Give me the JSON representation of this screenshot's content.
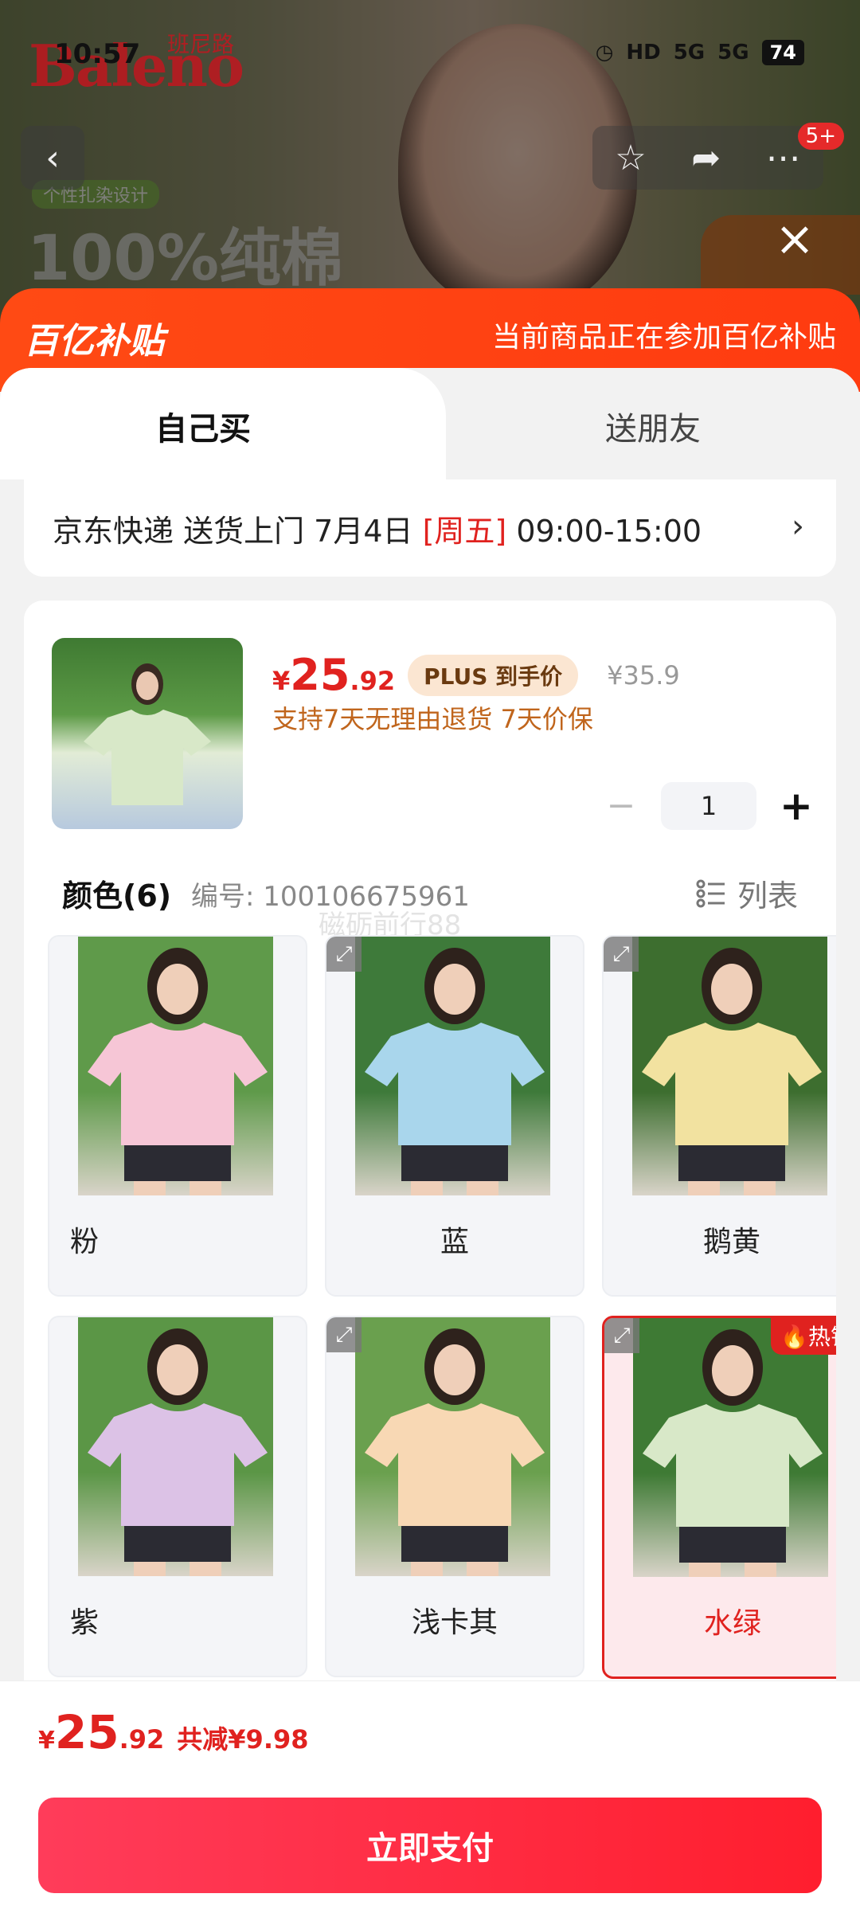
{
  "status_bar": {
    "time": "10:57",
    "icons": [
      "HD",
      "5G",
      "5G"
    ],
    "battery": "74"
  },
  "background": {
    "brand": "Baleno",
    "brand_cn": "班尼路",
    "tag": "个性扎染设计",
    "headline": "100%纯棉",
    "badge_count": "5+"
  },
  "subsidy": {
    "logo": "百亿补贴",
    "text": "当前商品正在参加百亿补贴"
  },
  "tabs": [
    {
      "label": "自己买"
    },
    {
      "label": "送朋友"
    }
  ],
  "delivery": {
    "prefix": "京东快递 送货上门 7月4日 ",
    "weekday": "[周五]",
    "time": " 09:00-15:00",
    "arrow": "›"
  },
  "product": {
    "price_symbol": "¥",
    "price_int": "25",
    "price_dec": ".92",
    "plus_badge": "PLUS 到手价",
    "original_price": "¥35.9",
    "service": "支持7天无理由退货  7天价保",
    "quantity": "1"
  },
  "colors": {
    "title": "颜色(6)",
    "sku": "编号: 100106675961",
    "list_label": "列表",
    "watermark": "磁砺前行88",
    "hot_label": "热销",
    "items": [
      {
        "label": "粉",
        "shirt": "#f6c6d6",
        "bg": "#5f9a4a"
      },
      {
        "label": "蓝",
        "shirt": "#a9d6ec",
        "bg": "#3e7a3a"
      },
      {
        "label": "鹅黄",
        "shirt": "#f2e2a0",
        "bg": "#3d6e2f"
      },
      {
        "label": "紫",
        "shirt": "#dcc2e6",
        "bg": "#5b9646"
      },
      {
        "label": "浅卡其",
        "shirt": "#f8d8b4",
        "bg": "#6aa04e"
      },
      {
        "label": "水绿",
        "shirt": "#d8e8c8",
        "bg": "#3e7a34"
      }
    ]
  },
  "footer": {
    "price_symbol": "¥",
    "price_int": "25",
    "price_dec": ".92",
    "saving": "共减¥9.98",
    "pay_label": "立即支付"
  }
}
